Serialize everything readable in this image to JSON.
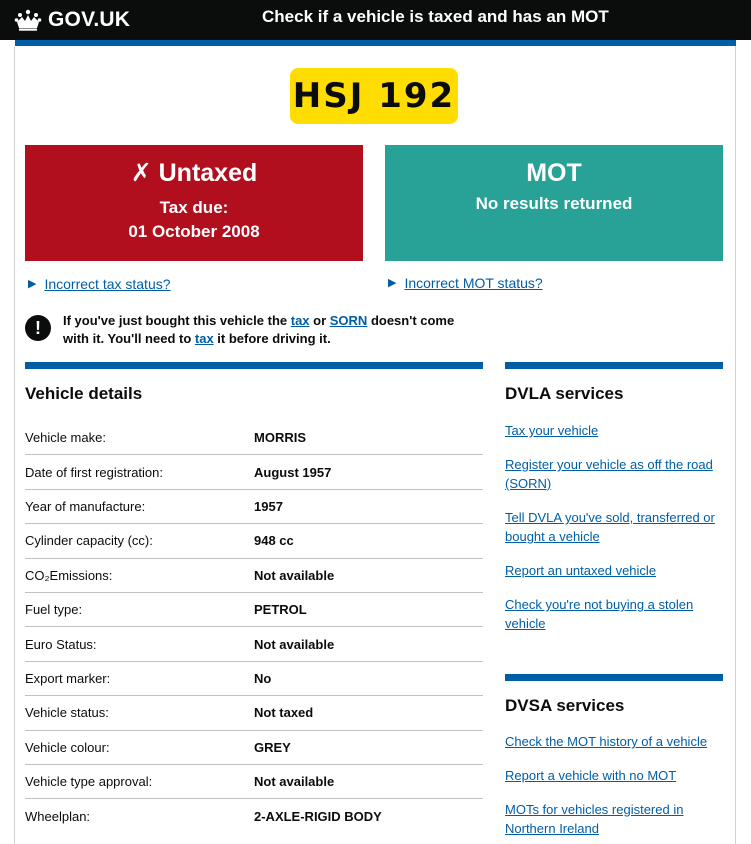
{
  "header": {
    "brand": "GOV.UK",
    "crown_icon": "crown-icon",
    "service_name": "Check if a vehicle is taxed and has an MOT"
  },
  "vehicle": {
    "registration": "HSJ 192"
  },
  "tax_status": {
    "icon": "cross-icon",
    "icon_glyph": "✗",
    "title": "Untaxed",
    "line1": "Tax due:",
    "line2": "01 October 2008",
    "color": "#b10e1e"
  },
  "mot_status": {
    "title": "MOT",
    "line1": "No results returned",
    "color": "#28a197"
  },
  "links": {
    "incorrect_tax": "Incorrect tax status?",
    "incorrect_mot": "Incorrect MOT status?"
  },
  "notice": {
    "icon": "exclamation-icon",
    "part1": "If you've just bought this vehicle the ",
    "link_tax": "tax",
    "part2": " or ",
    "link_sorn": "SORN",
    "part3": " doesn't come with it. You'll need to ",
    "link_tax2": "tax",
    "part4": " it before driving it."
  },
  "details": {
    "title": "Vehicle details",
    "rows": [
      {
        "label": "Vehicle make:",
        "value": "MORRIS"
      },
      {
        "label": "Date of first registration:",
        "value": "August 1957"
      },
      {
        "label": "Year of manufacture:",
        "value": "1957"
      },
      {
        "label": "Cylinder capacity (cc):",
        "value": "948 cc"
      },
      {
        "label": "CO₂Emissions:",
        "value": "Not available"
      },
      {
        "label": "Fuel type:",
        "value": "PETROL"
      },
      {
        "label": "Euro Status:",
        "value": "Not available"
      },
      {
        "label": "Export marker:",
        "value": "No"
      },
      {
        "label": "Vehicle status:",
        "value": "Not taxed"
      },
      {
        "label": "Vehicle colour:",
        "value": "GREY"
      },
      {
        "label": "Vehicle type approval:",
        "value": "Not available"
      },
      {
        "label": "Wheelplan:",
        "value": "2-AXLE-RIGID BODY"
      }
    ]
  },
  "dvla": {
    "title": "DVLA services",
    "items": [
      "Tax your vehicle",
      "Register your vehicle as off the road (SORN)",
      "Tell DVLA you've sold, transferred or bought a vehicle",
      "Report an untaxed vehicle",
      "Check you're not buying a stolen vehicle"
    ]
  },
  "dvsa": {
    "title": "DVSA services",
    "items": [
      "Check the MOT history of a vehicle",
      "Report a vehicle with no MOT",
      "MOTs for vehicles registered in Northern Ireland"
    ]
  },
  "colors": {
    "link": "#005ea5",
    "accent": "#005ea5",
    "plate": "#ffdd00",
    "header": "#0b0c0c"
  }
}
